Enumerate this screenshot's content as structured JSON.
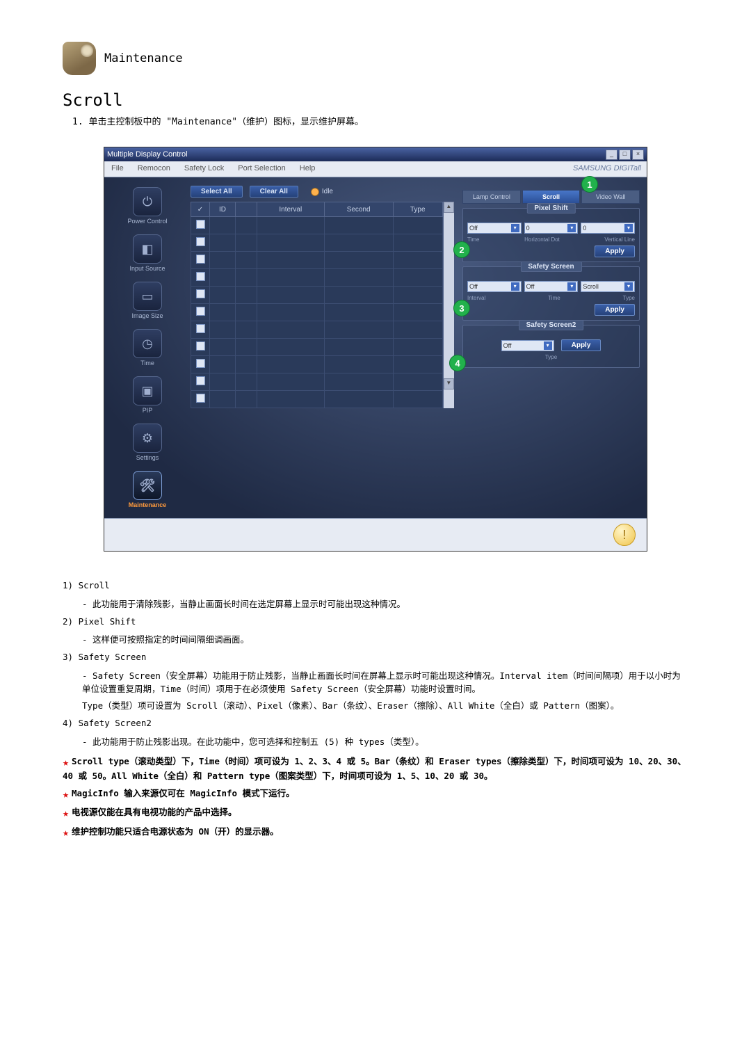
{
  "header": {
    "title": "Maintenance"
  },
  "section": {
    "title": "Scroll"
  },
  "step": {
    "num": "1.",
    "text": "单击主控制板中的 \"Maintenance\"（维护）图标，显示维护屏幕。"
  },
  "shot": {
    "window_title": "Multiple Display Control",
    "brand": "SAMSUNG DIGITall",
    "menubar": [
      "File",
      "Remocon",
      "Safety Lock",
      "Port Selection",
      "Help"
    ],
    "left_nav": [
      {
        "label": "Power Control",
        "glyph": "⏻"
      },
      {
        "label": "Input Source",
        "glyph": "◧"
      },
      {
        "label": "Image Size",
        "glyph": "▭"
      },
      {
        "label": "Time",
        "glyph": "◷"
      },
      {
        "label": "PIP",
        "glyph": "▣"
      },
      {
        "label": "Settings",
        "glyph": "⚙"
      },
      {
        "label": "Maintenance",
        "glyph": "🛠"
      }
    ],
    "top_buttons": {
      "select_all": "Select All",
      "clear_all": "Clear All",
      "idle": "Idle"
    },
    "grid_headers": {
      "check": "✓",
      "id": "ID",
      "power": "",
      "interval": "Interval",
      "second": "Second",
      "type": "Type"
    },
    "tabs": {
      "lamp": "Lamp Control",
      "scroll": "Scroll",
      "video_wall": "Video Wall"
    },
    "pixel_shift": {
      "title": "Pixel Shift",
      "off": "Off",
      "v1": "0",
      "v2": "0",
      "l_time": "Time",
      "l_hd": "Horizontal Dot",
      "l_vl": "Vertical Line",
      "apply": "Apply"
    },
    "safety_screen": {
      "title": "Safety Screen",
      "off1": "Off",
      "off2": "Off",
      "scroll": "Scroll",
      "l_interval": "Interval",
      "l_time": "Time",
      "l_type": "Type",
      "apply": "Apply"
    },
    "safety_screen2": {
      "title": "Safety Screen2",
      "off": "Off",
      "l_type": "Type",
      "apply": "Apply"
    },
    "badges": {
      "b1": "1",
      "b2": "2",
      "b3": "3",
      "b4": "4"
    },
    "win_buttons": {
      "min": "_",
      "max": "□",
      "close": "×"
    }
  },
  "desc": {
    "d1_h": "1) Scroll",
    "d1_s": "- 此功能用于清除残影，当静止画面长时间在选定屏幕上显示时可能出现这种情况。",
    "d2_h": "2) Pixel Shift",
    "d2_s": "- 这样便可按照指定的时间间隔细调画面。",
    "d3_h": "3) Safety Screen",
    "d3_s1": "- Safety Screen（安全屏幕）功能用于防止残影，当静止画面长时间在屏幕上显示时可能出现这种情况。Interval item（时间间隔项）用于以小时为单位设置重复周期，Time（时间）项用于在必须使用 Safety Screen（安全屏幕）功能时设置时间。",
    "d3_s2": "Type（类型）项可设置为 Scroll（滚动）、Pixel（像素）、Bar（条纹）、Eraser（擦除）、All White（全白）或 Pattern（图案）。",
    "d4_h": "4) Safety Screen2",
    "d4_s": "- 此功能用于防止残影出现。在此功能中，您可选择和控制五 (5) 种 types（类型）。"
  },
  "stars": {
    "s1": "Scroll type（滚动类型）下，Time（时间）项可设为 1、2、3、4 或 5。Bar（条纹）和 Eraser types（擦除类型）下，时间项可设为 10、20、30、40 或 50。All White（全白）和 Pattern type（图案类型）下，时间项可设为 1、5、10、20 或 30。",
    "s2": "MagicInfo 输入来源仅可在 MagicInfo 模式下运行。",
    "s3": "电视源仅能在具有电视功能的产品中选择。",
    "s4": "维护控制功能只适合电源状态为 ON（开）的显示器。"
  }
}
